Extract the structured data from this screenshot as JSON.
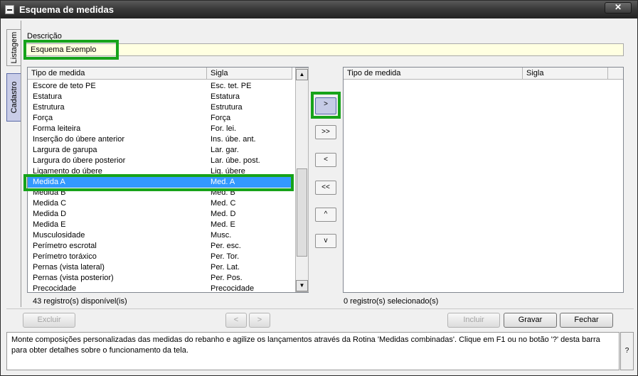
{
  "window": {
    "title": "Esquema de medidas",
    "close_symbol": "✕"
  },
  "side_tabs": {
    "listagem": "Listagem",
    "cadastro": "Cadastro"
  },
  "form": {
    "descricao_label": "Descrição",
    "descricao_value": "Esquema Exemplo"
  },
  "left_grid": {
    "headers": [
      "Tipo de medida",
      "Sigla"
    ],
    "rows": [
      [
        "Escore de teto PE",
        "Esc. tet. PE"
      ],
      [
        "Estatura",
        "Estatura"
      ],
      [
        "Estrutura",
        "Estrutura"
      ],
      [
        "Força",
        "Força"
      ],
      [
        "Forma leiteira",
        "For. lei."
      ],
      [
        "Inserção do úbere anterior",
        "Ins. úbe. ant."
      ],
      [
        "Largura de garupa",
        "Lar. gar."
      ],
      [
        "Largura do úbere posterior",
        "Lar. úbe. post."
      ],
      [
        "Ligamento do úbere",
        "Lig.  úbere"
      ],
      [
        "Medida A",
        "Med. A"
      ],
      [
        "Medida B",
        "Med. B"
      ],
      [
        "Medida C",
        "Med. C"
      ],
      [
        "Medida D",
        "Med. D"
      ],
      [
        "Medida E",
        "Med. E"
      ],
      [
        "Musculosidade",
        "Musc."
      ],
      [
        "Perímetro escrotal",
        "Per. esc."
      ],
      [
        "Perímetro toráxico",
        "Per. Tor."
      ],
      [
        "Pernas (vista lateral)",
        "Per.  Lat."
      ],
      [
        "Pernas (vista posterior)",
        "Per.  Pos."
      ],
      [
        "Precocidade",
        "Precocidade"
      ]
    ],
    "selected_row": 9,
    "footer": "43 registro(s) disponível(is)",
    "scroll_up": "▲",
    "scroll_down": "▼"
  },
  "move_buttons": {
    "add_one": ">",
    "add_all": ">>",
    "remove_one": "<",
    "remove_all": "<<",
    "up": "^",
    "down": "v"
  },
  "right_grid": {
    "headers": [
      "Tipo de medida",
      "Sigla"
    ],
    "footer": "0 registro(s) selecionado(s)"
  },
  "bottom": {
    "excluir": "Excluir",
    "prev": "<",
    "next": ">",
    "incluir": "Incluir",
    "gravar": "Gravar",
    "fechar": "Fechar"
  },
  "info": {
    "text": "Monte composições personalizadas das medidas do rebanho e agilize os lançamentos através da Rotina 'Medidas combinadas'. Clique em F1 ou no botão '?' desta barra para obter detalhes sobre o funcionamento da tela.",
    "help": "?"
  }
}
